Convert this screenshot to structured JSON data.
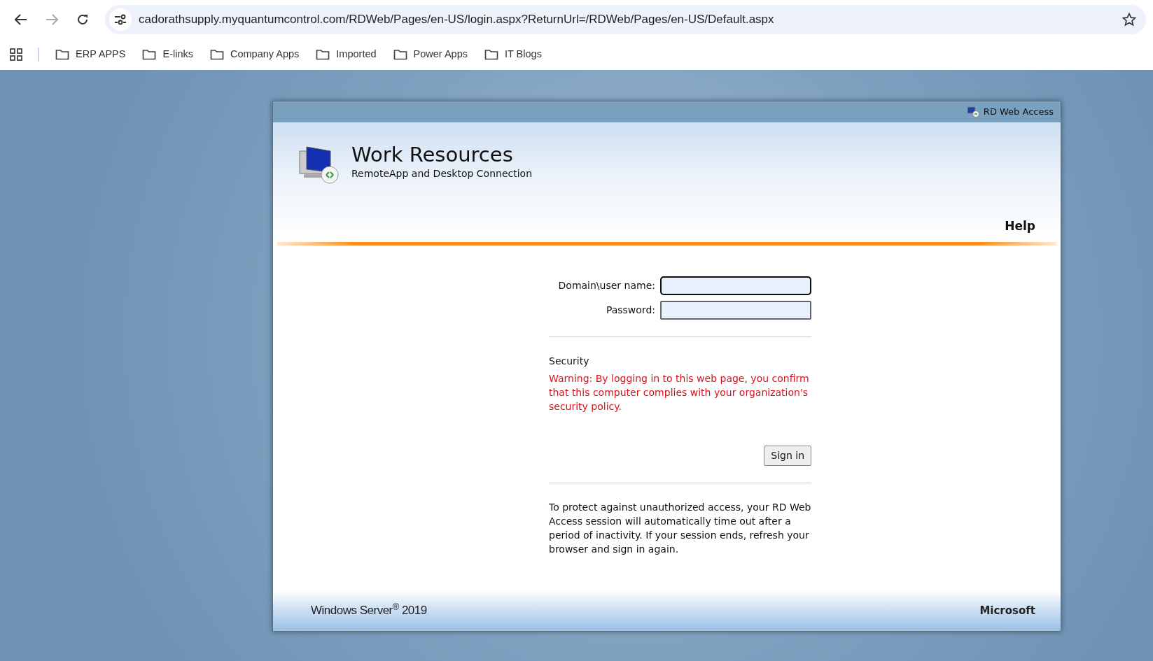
{
  "browser": {
    "url": "cadorathsupply.myquantumcontrol.com/RDWeb/Pages/en-US/login.aspx?ReturnUrl=/RDWeb/Pages/en-US/Default.aspx",
    "bookmarks": [
      {
        "label": "ERP APPS"
      },
      {
        "label": "E-links"
      },
      {
        "label": "Company Apps"
      },
      {
        "label": "Imported"
      },
      {
        "label": "Power Apps"
      },
      {
        "label": "IT Blogs"
      }
    ]
  },
  "panel": {
    "top_label": "RD Web Access",
    "title": "Work Resources",
    "subtitle": "RemoteApp and Desktop Connection",
    "help": "Help",
    "fields": [
      {
        "label": "Domain\\user name:",
        "focused": true
      },
      {
        "label": "Password:",
        "focused": false
      }
    ],
    "security_heading": "Security",
    "warning": "Warning: By logging in to this web page, you confirm that this computer complies with your organization's security policy.",
    "sign_in": "Sign in",
    "notice": "To protect against unauthorized access, your RD Web Access session will automatically time out after a period of inactivity. If your session ends, refresh your browser and sign in again.",
    "footer_left": "Windows Server$^{®}$ 2019",
    "footer_right": "Microsoft"
  }
}
